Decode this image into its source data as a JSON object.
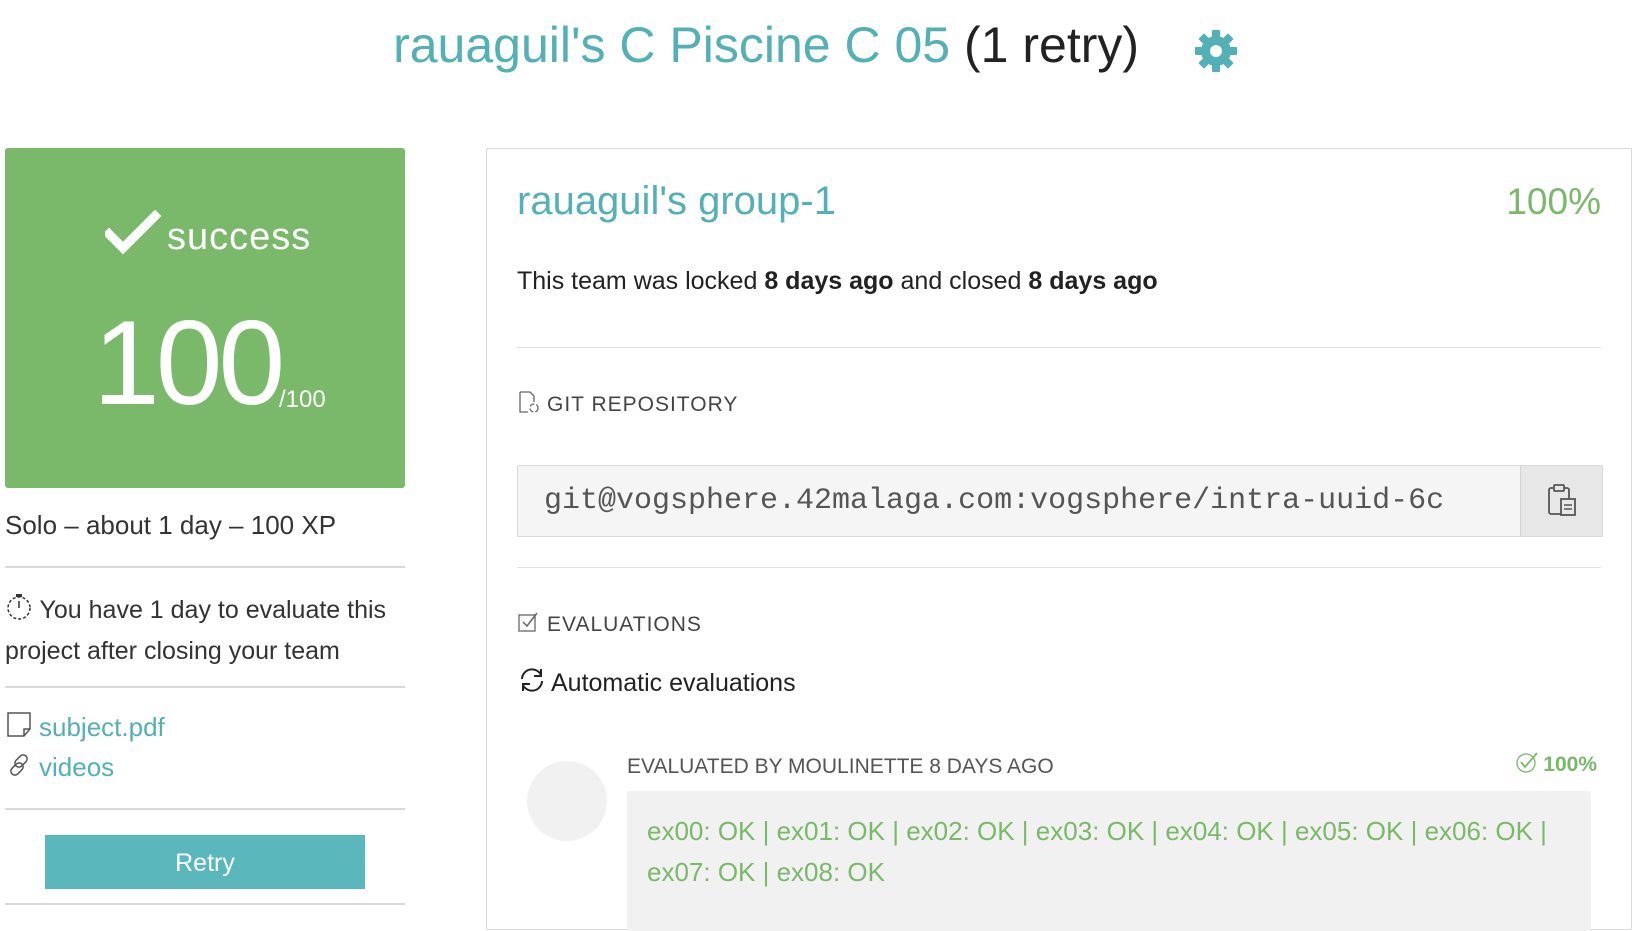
{
  "header": {
    "title_link": "rauaguil's C Piscine C 05",
    "title_suffix": "(1 retry)",
    "settings_icon": "gear-icon"
  },
  "score": {
    "status": "success",
    "value": "100",
    "out_of": "/100",
    "color": "#7ab86a"
  },
  "project_meta": "Solo – about 1 day – 100 XP",
  "evaluation_note": "You have 1 day to evaluate this project after closing your team",
  "resources": {
    "subject": "subject.pdf",
    "videos": "videos"
  },
  "retry_label": "Retry",
  "team": {
    "name": "rauaguil's group-1",
    "percent": "100%",
    "lock_prefix": "This team was locked ",
    "locked_time": "8 days ago",
    "lock_middle": " and closed ",
    "closed_time": "8 days ago"
  },
  "git": {
    "section_label": "GIT REPOSITORY",
    "url": "git@vogsphere.42malaga.com:vogsphere/intra-uuid-6c"
  },
  "evaluations": {
    "section_label": "EVALUATIONS",
    "automatic_label": "Automatic evaluations",
    "evaluated_by": "EVALUATED BY MOULINETTE 8 DAYS AGO",
    "percent": "100%",
    "result": "ex00: OK | ex01: OK | ex02: OK | ex03: OK | ex04: OK | ex05: OK | ex06: OK | ex07: OK | ex08: OK"
  },
  "colors": {
    "accent": "#53b0b4",
    "success": "#7ab86a",
    "button": "#5ab8bc"
  }
}
